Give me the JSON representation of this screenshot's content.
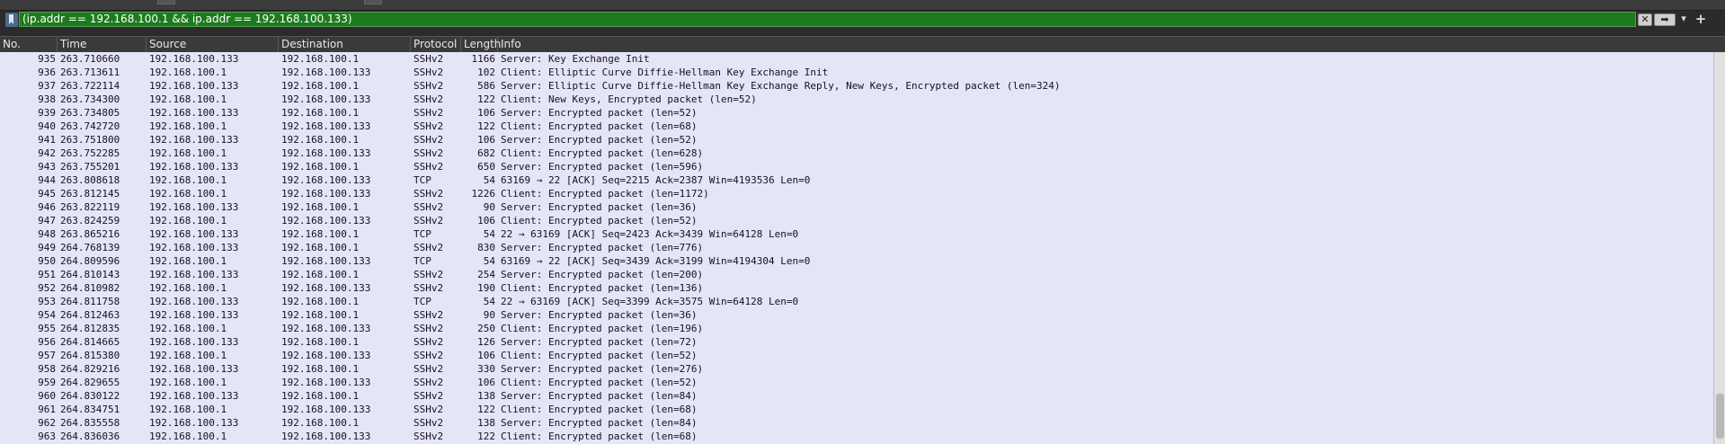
{
  "filter": {
    "expression": "(ip.addr == 192.168.100.1 && ip.addr == 192.168.100.133)",
    "clear_icon": "✕",
    "apply_icon": "➡",
    "dropdown_icon": "▾",
    "add_icon": "+"
  },
  "columns": {
    "no": "No.",
    "time": "Time",
    "source": "Source",
    "destination": "Destination",
    "protocol": "Protocol",
    "length": "Length",
    "info": "Info"
  },
  "packets": [
    {
      "no": "935",
      "time": "263.710660",
      "src": "192.168.100.133",
      "dst": "192.168.100.1",
      "proto": "SSHv2",
      "len": "1166",
      "info": "Server: Key Exchange Init"
    },
    {
      "no": "936",
      "time": "263.713611",
      "src": "192.168.100.1",
      "dst": "192.168.100.133",
      "proto": "SSHv2",
      "len": "102",
      "info": "Client: Elliptic Curve Diffie-Hellman Key Exchange Init"
    },
    {
      "no": "937",
      "time": "263.722114",
      "src": "192.168.100.133",
      "dst": "192.168.100.1",
      "proto": "SSHv2",
      "len": "586",
      "info": "Server: Elliptic Curve Diffie-Hellman Key Exchange Reply, New Keys, Encrypted packet (len=324)"
    },
    {
      "no": "938",
      "time": "263.734300",
      "src": "192.168.100.1",
      "dst": "192.168.100.133",
      "proto": "SSHv2",
      "len": "122",
      "info": "Client: New Keys, Encrypted packet (len=52)"
    },
    {
      "no": "939",
      "time": "263.734805",
      "src": "192.168.100.133",
      "dst": "192.168.100.1",
      "proto": "SSHv2",
      "len": "106",
      "info": "Server: Encrypted packet (len=52)"
    },
    {
      "no": "940",
      "time": "263.742720",
      "src": "192.168.100.1",
      "dst": "192.168.100.133",
      "proto": "SSHv2",
      "len": "122",
      "info": "Client: Encrypted packet (len=68)"
    },
    {
      "no": "941",
      "time": "263.751800",
      "src": "192.168.100.133",
      "dst": "192.168.100.1",
      "proto": "SSHv2",
      "len": "106",
      "info": "Server: Encrypted packet (len=52)"
    },
    {
      "no": "942",
      "time": "263.752285",
      "src": "192.168.100.1",
      "dst": "192.168.100.133",
      "proto": "SSHv2",
      "len": "682",
      "info": "Client: Encrypted packet (len=628)"
    },
    {
      "no": "943",
      "time": "263.755201",
      "src": "192.168.100.133",
      "dst": "192.168.100.1",
      "proto": "SSHv2",
      "len": "650",
      "info": "Server: Encrypted packet (len=596)"
    },
    {
      "no": "944",
      "time": "263.808618",
      "src": "192.168.100.1",
      "dst": "192.168.100.133",
      "proto": "TCP",
      "len": "54",
      "info": "63169 → 22 [ACK] Seq=2215 Ack=2387 Win=4193536 Len=0"
    },
    {
      "no": "945",
      "time": "263.812145",
      "src": "192.168.100.1",
      "dst": "192.168.100.133",
      "proto": "SSHv2",
      "len": "1226",
      "info": "Client: Encrypted packet (len=1172)"
    },
    {
      "no": "946",
      "time": "263.822119",
      "src": "192.168.100.133",
      "dst": "192.168.100.1",
      "proto": "SSHv2",
      "len": "90",
      "info": "Server: Encrypted packet (len=36)"
    },
    {
      "no": "947",
      "time": "263.824259",
      "src": "192.168.100.1",
      "dst": "192.168.100.133",
      "proto": "SSHv2",
      "len": "106",
      "info": "Client: Encrypted packet (len=52)"
    },
    {
      "no": "948",
      "time": "263.865216",
      "src": "192.168.100.133",
      "dst": "192.168.100.1",
      "proto": "TCP",
      "len": "54",
      "info": "22 → 63169 [ACK] Seq=2423 Ack=3439 Win=64128 Len=0"
    },
    {
      "no": "949",
      "time": "264.768139",
      "src": "192.168.100.133",
      "dst": "192.168.100.1",
      "proto": "SSHv2",
      "len": "830",
      "info": "Server: Encrypted packet (len=776)"
    },
    {
      "no": "950",
      "time": "264.809596",
      "src": "192.168.100.1",
      "dst": "192.168.100.133",
      "proto": "TCP",
      "len": "54",
      "info": "63169 → 22 [ACK] Seq=3439 Ack=3199 Win=4194304 Len=0"
    },
    {
      "no": "951",
      "time": "264.810143",
      "src": "192.168.100.133",
      "dst": "192.168.100.1",
      "proto": "SSHv2",
      "len": "254",
      "info": "Server: Encrypted packet (len=200)"
    },
    {
      "no": "952",
      "time": "264.810982",
      "src": "192.168.100.1",
      "dst": "192.168.100.133",
      "proto": "SSHv2",
      "len": "190",
      "info": "Client: Encrypted packet (len=136)"
    },
    {
      "no": "953",
      "time": "264.811758",
      "src": "192.168.100.133",
      "dst": "192.168.100.1",
      "proto": "TCP",
      "len": "54",
      "info": "22 → 63169 [ACK] Seq=3399 Ack=3575 Win=64128 Len=0"
    },
    {
      "no": "954",
      "time": "264.812463",
      "src": "192.168.100.133",
      "dst": "192.168.100.1",
      "proto": "SSHv2",
      "len": "90",
      "info": "Server: Encrypted packet (len=36)"
    },
    {
      "no": "955",
      "time": "264.812835",
      "src": "192.168.100.1",
      "dst": "192.168.100.133",
      "proto": "SSHv2",
      "len": "250",
      "info": "Client: Encrypted packet (len=196)"
    },
    {
      "no": "956",
      "time": "264.814665",
      "src": "192.168.100.133",
      "dst": "192.168.100.1",
      "proto": "SSHv2",
      "len": "126",
      "info": "Server: Encrypted packet (len=72)"
    },
    {
      "no": "957",
      "time": "264.815380",
      "src": "192.168.100.1",
      "dst": "192.168.100.133",
      "proto": "SSHv2",
      "len": "106",
      "info": "Client: Encrypted packet (len=52)"
    },
    {
      "no": "958",
      "time": "264.829216",
      "src": "192.168.100.133",
      "dst": "192.168.100.1",
      "proto": "SSHv2",
      "len": "330",
      "info": "Server: Encrypted packet (len=276)"
    },
    {
      "no": "959",
      "time": "264.829655",
      "src": "192.168.100.1",
      "dst": "192.168.100.133",
      "proto": "SSHv2",
      "len": "106",
      "info": "Client: Encrypted packet (len=52)"
    },
    {
      "no": "960",
      "time": "264.830122",
      "src": "192.168.100.133",
      "dst": "192.168.100.1",
      "proto": "SSHv2",
      "len": "138",
      "info": "Server: Encrypted packet (len=84)"
    },
    {
      "no": "961",
      "time": "264.834751",
      "src": "192.168.100.1",
      "dst": "192.168.100.133",
      "proto": "SSHv2",
      "len": "122",
      "info": "Client: Encrypted packet (len=68)"
    },
    {
      "no": "962",
      "time": "264.835558",
      "src": "192.168.100.133",
      "dst": "192.168.100.1",
      "proto": "SSHv2",
      "len": "138",
      "info": "Server: Encrypted packet (len=84)"
    },
    {
      "no": "963",
      "time": "264.836036",
      "src": "192.168.100.1",
      "dst": "192.168.100.133",
      "proto": "SSHv2",
      "len": "122",
      "info": "Client: Encrypted packet (len=68)"
    }
  ]
}
